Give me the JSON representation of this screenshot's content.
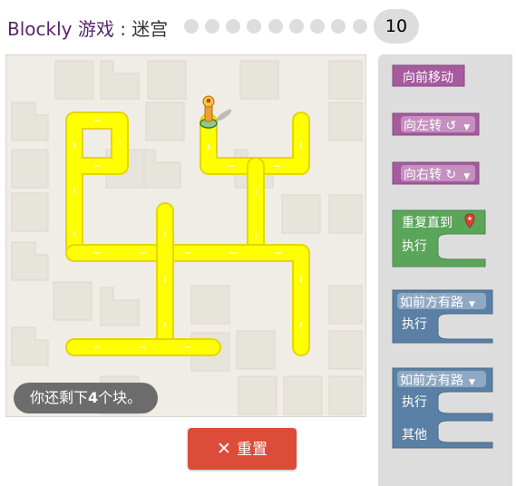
{
  "header": {
    "app_name": "Blockly",
    "game_word": "游戏",
    "separator": " : ",
    "game_title": "迷宫",
    "levels_total_dots": 9,
    "current_level": "10"
  },
  "maze": {
    "status": "你还剩下",
    "remaining_count": "4",
    "status_suffix": "个块。",
    "path_color": "#ffff00",
    "background_color": "#f0ede6"
  },
  "reset_button": {
    "icon": "close-icon",
    "label": "重置",
    "color": "#dd4b39"
  },
  "toolbox": {
    "move_forward": "向前移动",
    "turn_left": "向左转 ↺",
    "turn_right": "向右转 ↻",
    "repeat_until": "重复直到",
    "repeat_do": "执行",
    "if_path": "如前方有路",
    "if_do": "执行",
    "ifelse_path": "如前方有路",
    "ifelse_do": "执行",
    "ifelse_else": "其他",
    "colors": {
      "movement": "#a55b9e",
      "loop": "#5ba55b",
      "logic": "#5b80a5"
    }
  }
}
